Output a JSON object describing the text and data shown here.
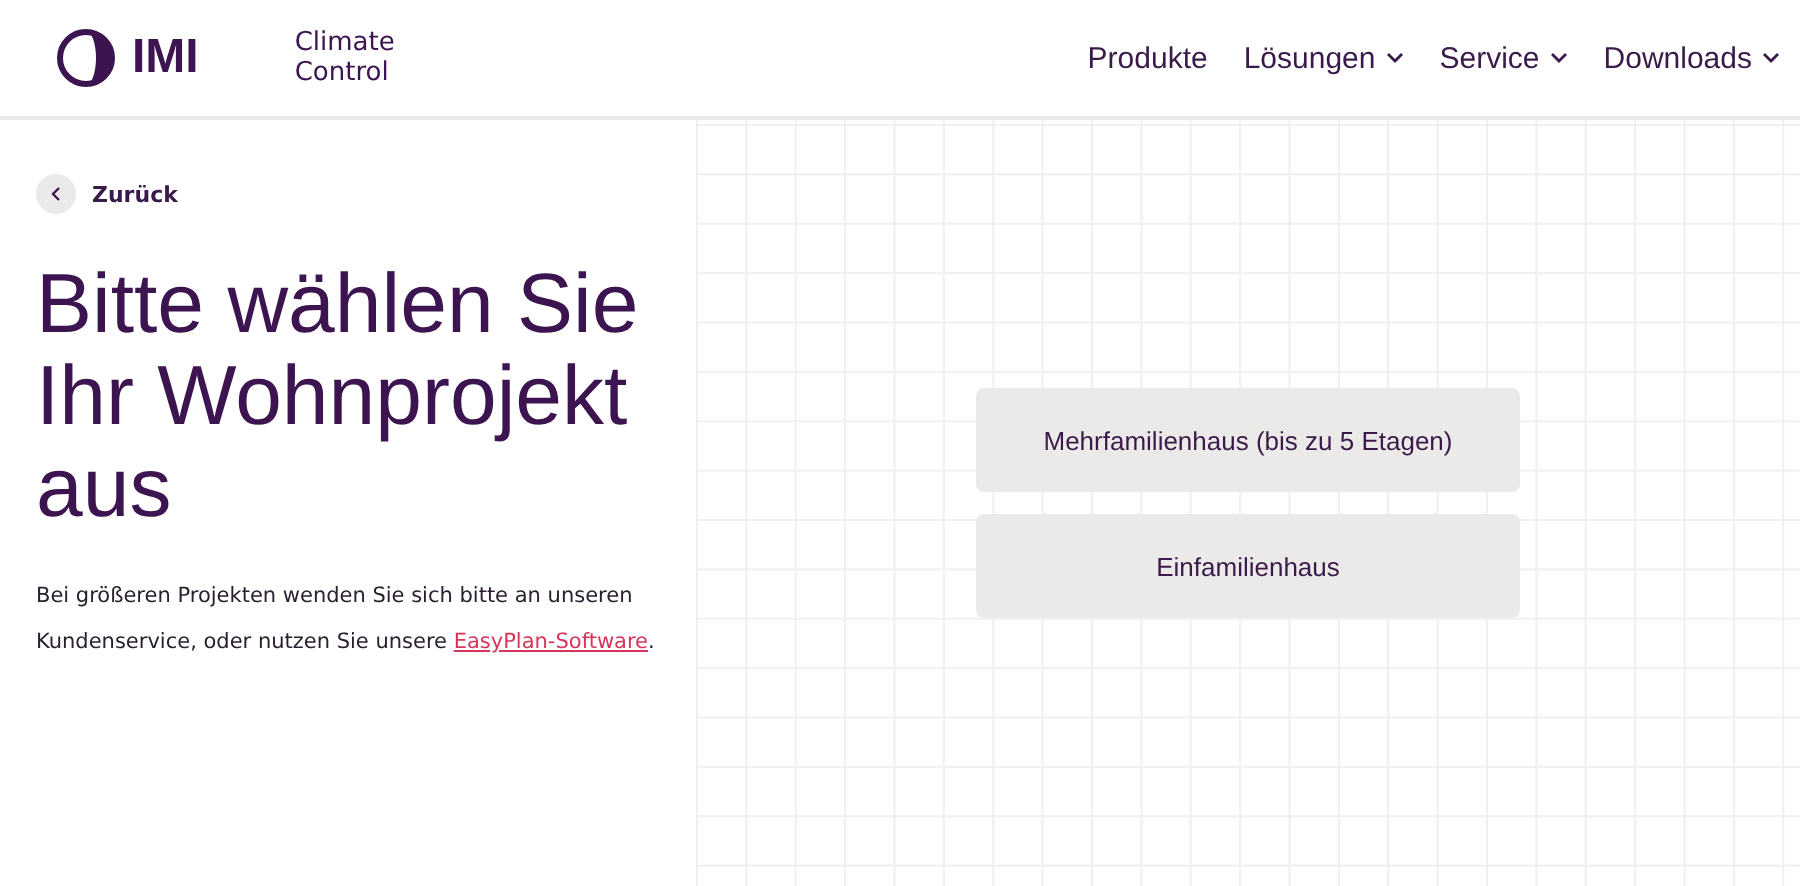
{
  "header": {
    "logo": "IMI",
    "brand_line": "Climate Control",
    "nav": [
      {
        "label": "Produkte",
        "has_menu": false
      },
      {
        "label": "Lösungen",
        "has_menu": true
      },
      {
        "label": "Service",
        "has_menu": true
      },
      {
        "label": "Downloads",
        "has_menu": true
      }
    ]
  },
  "back_link": "Zurück",
  "title": "Bitte wählen Sie Ihr Wohnprojekt aus",
  "intro": {
    "before": "Bei größeren Projekten wenden Sie sich bitte an unseren Kundenservice, oder nutzen Sie unsere ",
    "link": "EasyPlan-Software",
    "after": "."
  },
  "options": [
    {
      "label": "Mehrfamilienhaus (bis zu 5 Etagen)"
    },
    {
      "label": "Einfamilienhaus"
    }
  ]
}
